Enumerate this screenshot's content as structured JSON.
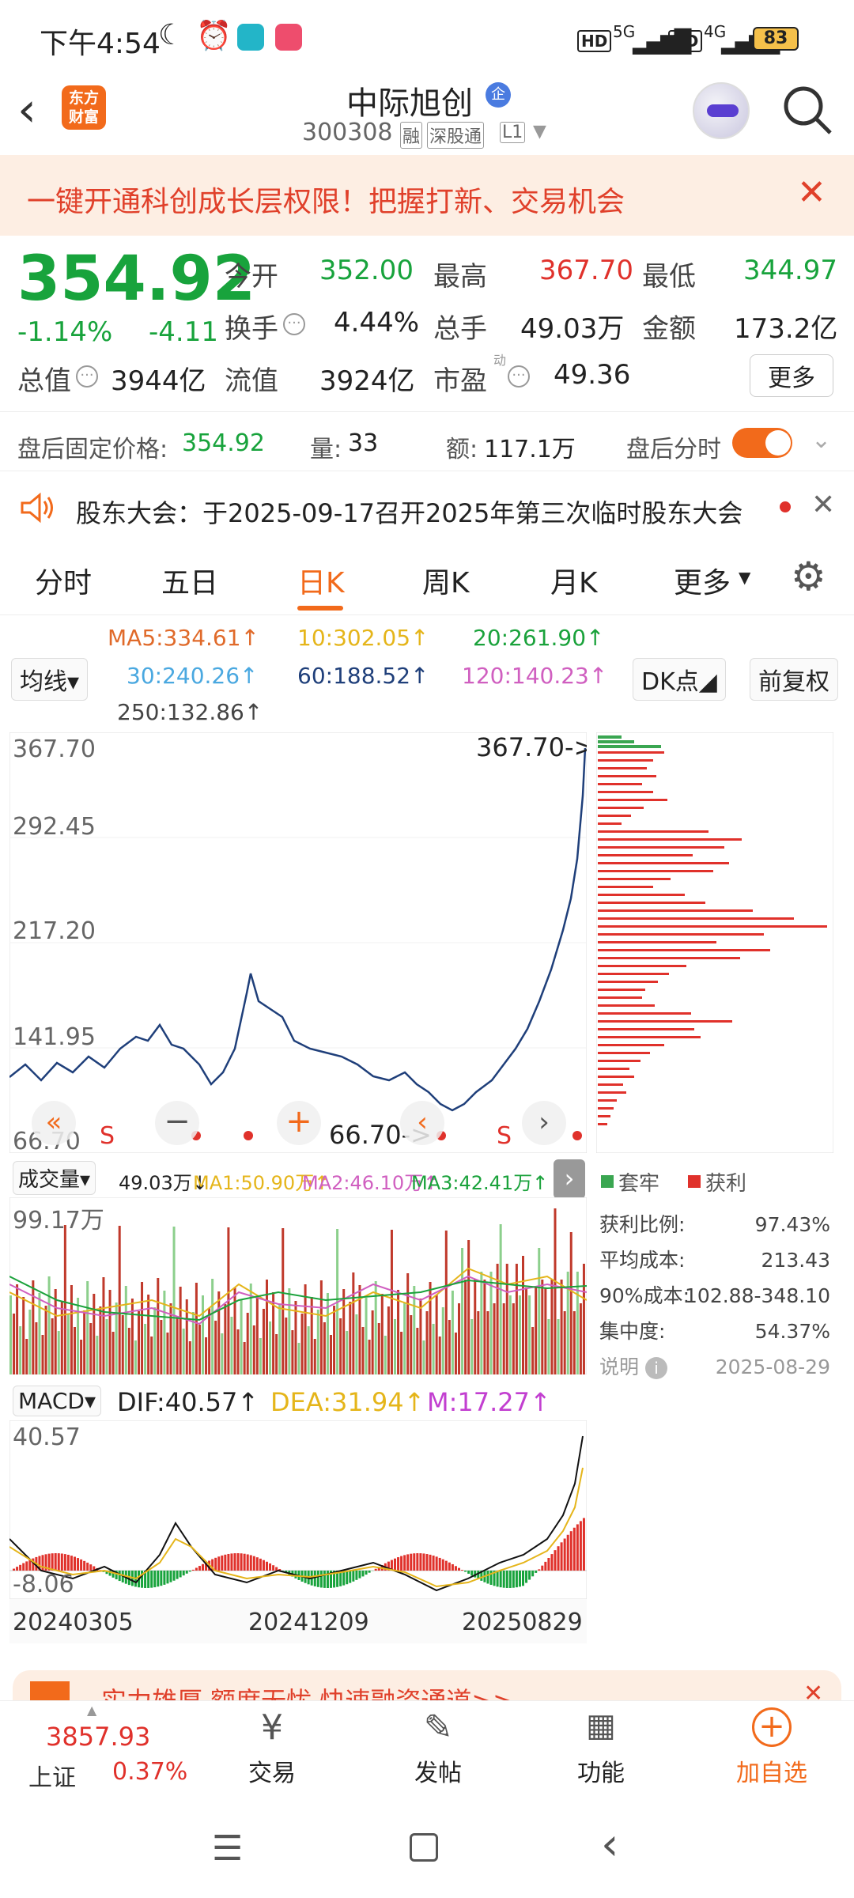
{
  "status_bar": {
    "time": "下午4:54",
    "network1": "5G",
    "network2": "4G",
    "battery": "83"
  },
  "header": {
    "title": "中际旭创",
    "code": "300308",
    "tag_rong": "融",
    "tag_sgt": "深股通",
    "tag_level": "L1",
    "logo_line1": "东方",
    "logo_line2": "财富"
  },
  "banner": {
    "text": "一键开通科创成长层权限！把握打新、交易机会"
  },
  "quote": {
    "price": "354.92",
    "change_pct": "-1.14%",
    "change_abs": "-4.11",
    "open_label": "今开",
    "open": "352.00",
    "high_label": "最高",
    "high": "367.70",
    "low_label": "最低",
    "low": "344.97",
    "turnover_label": "换手",
    "turnover": "4.44%",
    "volume_label": "总手",
    "volume": "49.03万",
    "amount_label": "金额",
    "amount": "173.2亿",
    "mcap_label": "总值",
    "mcap": "3944亿",
    "float_label": "流值",
    "float": "3924亿",
    "pe_label": "市盈",
    "pe_sup": "动",
    "pe": "49.36",
    "more": "更多"
  },
  "after_hours": {
    "price_label": "盘后固定价格:",
    "price": "354.92",
    "vol_label": "量:",
    "vol": "33",
    "amt_label": "额:",
    "amt": "117.1万",
    "toggle_label": "盘后分时"
  },
  "notice": {
    "text": "股东大会：于2025-09-17召开2025年第三次临时股东大会"
  },
  "tabs": [
    "分时",
    "五日",
    "日K",
    "周K",
    "月K",
    "更多"
  ],
  "active_tab": "日K",
  "ma_row": {
    "selector": "均线",
    "ma5": "MA5:334.61↑",
    "ma10": "10:302.05↑",
    "ma20": "20:261.90↑",
    "ma30": "30:240.26↑",
    "ma60": "60:188.52↑",
    "ma120": "120:140.23↑",
    "ma250": "250:132.86↑",
    "dk": "DK点",
    "fq": "前复权"
  },
  "kchart": {
    "y_labels": [
      "367.70",
      "292.45",
      "217.20",
      "141.95",
      "66.70"
    ],
    "max_marker": "367.70->",
    "min_marker": "66.70->",
    "s_marker": "S"
  },
  "chip": {
    "legend_trapped": "套牢",
    "legend_profit": "获利",
    "profit_ratio_label": "获利比例:",
    "profit_ratio": "97.43%",
    "avg_cost_label": "平均成本:",
    "avg_cost": "213.43",
    "cost90_label": "90%成本:",
    "cost90": "102.88-348.10",
    "concentration_label": "集中度:",
    "concentration": "54.37%",
    "explain_label": "说明",
    "date": "2025-08-29"
  },
  "volume_chart": {
    "selector": "成交量",
    "vol": "49.03万↓",
    "ma1": "MA1:50.90万↑",
    "ma2": "MA2:46.10万↑",
    "ma3": "MA3:42.41万↑",
    "y_max": "99.17万"
  },
  "macd_chart": {
    "selector": "MACD",
    "dif": "DIF:40.57↑",
    "dea": "DEA:31.94↑",
    "m": "M:17.27↑",
    "y_max": "40.57",
    "y_min": "-8.06"
  },
  "x_dates": [
    "20240305",
    "20241209",
    "20250829"
  ],
  "promo": {
    "text": "实力雄厚  额度无忧  快速融资通道>>"
  },
  "bottom_nav": {
    "index_value": "3857.93",
    "index_name": "上证",
    "index_change": "0.37%",
    "trade": "交易",
    "post": "发帖",
    "functions": "功能",
    "watchlist": "加自选"
  },
  "colors": {
    "up": "#e0312b",
    "down": "#18a33c",
    "accent": "#f26a1b",
    "line": "#1f3f7a"
  }
}
